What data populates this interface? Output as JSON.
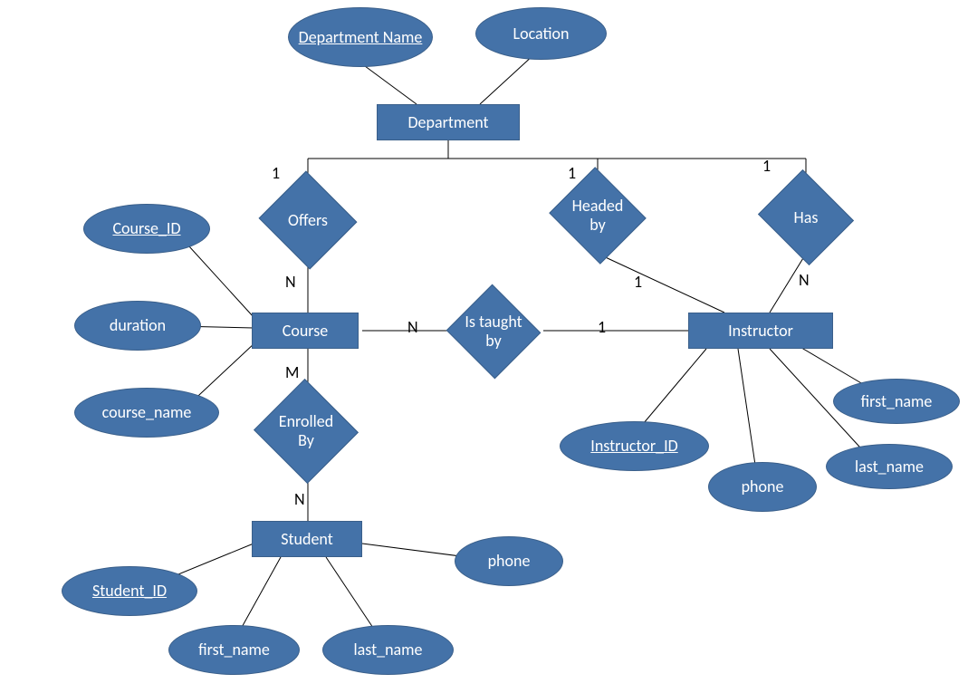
{
  "entities": {
    "department": "Department",
    "course": "Course",
    "instructor": "Instructor",
    "student": "Student"
  },
  "attributes": {
    "department_name": "Department Name",
    "location": "Location",
    "course_id": "Course_ID",
    "duration": "duration",
    "course_name": "course_name",
    "instructor_id": "Instructor_ID",
    "inst_first_name": "first_name",
    "inst_last_name": "last_name",
    "inst_phone": "phone",
    "student_id": "Student_ID",
    "stu_first_name": "first_name",
    "stu_last_name": "last_name",
    "stu_phone": "phone"
  },
  "relationships": {
    "offers": "Offers",
    "headed_by": "Headed by",
    "has": "Has",
    "is_taught_by": "Is taught by",
    "enrolled_by": "Enrolled By"
  },
  "cardinalities": {
    "offers_dept": "1",
    "offers_course": "N",
    "headed_dept": "1",
    "headed_inst": "1",
    "has_dept": "1",
    "has_inst": "N",
    "taught_course": "N",
    "taught_inst": "1",
    "enroll_course": "M",
    "enroll_student": "N"
  },
  "chart_data": {
    "type": "ERD",
    "entities": [
      {
        "name": "Department",
        "attributes": [
          "Department Name",
          "Location"
        ],
        "key": "Department Name"
      },
      {
        "name": "Course",
        "attributes": [
          "Course_ID",
          "duration",
          "course_name"
        ],
        "key": "Course_ID"
      },
      {
        "name": "Instructor",
        "attributes": [
          "Instructor_ID",
          "first_name",
          "last_name",
          "phone"
        ],
        "key": "Instructor_ID"
      },
      {
        "name": "Student",
        "attributes": [
          "Student_ID",
          "first_name",
          "last_name",
          "phone"
        ],
        "key": "Student_ID"
      }
    ],
    "relationships": [
      {
        "name": "Offers",
        "between": [
          "Department",
          "Course"
        ],
        "cardinality": [
          "1",
          "N"
        ]
      },
      {
        "name": "Headed by",
        "between": [
          "Department",
          "Instructor"
        ],
        "cardinality": [
          "1",
          "1"
        ]
      },
      {
        "name": "Has",
        "between": [
          "Department",
          "Instructor"
        ],
        "cardinality": [
          "1",
          "N"
        ]
      },
      {
        "name": "Is taught by",
        "between": [
          "Course",
          "Instructor"
        ],
        "cardinality": [
          "N",
          "1"
        ]
      },
      {
        "name": "Enrolled By",
        "between": [
          "Course",
          "Student"
        ],
        "cardinality": [
          "M",
          "N"
        ]
      }
    ]
  }
}
